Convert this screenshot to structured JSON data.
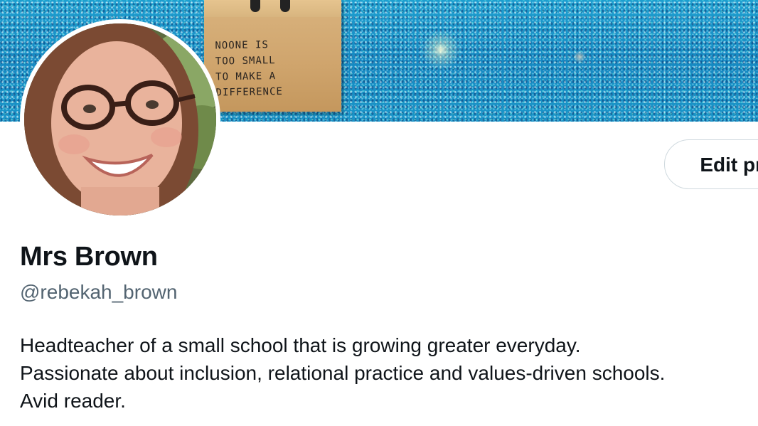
{
  "banner": {
    "sign_lines": [
      "NOONE IS",
      "TOO SMALL",
      "TO MAKE A",
      "DIFFERENCE"
    ]
  },
  "profile": {
    "display_name": "Mrs Brown",
    "handle": "@rebekah_brown",
    "edit_button_label": "Edit profile",
    "bio_lines": [
      "Headteacher of a small school that is growing greater everyday.",
      "Passionate about inclusion, relational practice and values-driven schools.",
      "Avid reader."
    ]
  },
  "colors": {
    "text_primary": "#0f1419",
    "text_secondary": "#536471",
    "button_border": "#cfd9de",
    "banner_glitter": "#1a95c8"
  }
}
